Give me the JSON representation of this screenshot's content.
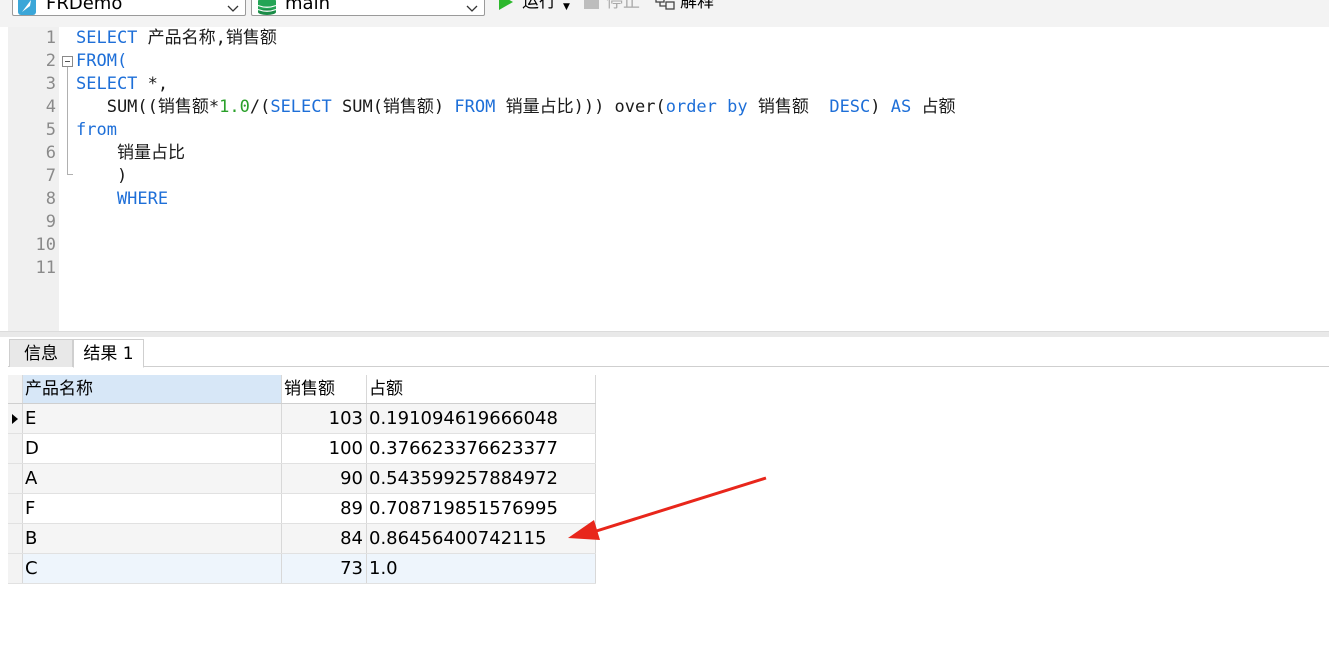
{
  "toolbar": {
    "connection": "FRDemo",
    "database": "main",
    "run_label": "运行",
    "stop_label": "停止",
    "explain_label": "解释",
    "icons": {
      "connection": "sqlite-feather-icon",
      "database": "database-icon",
      "run": "play-icon",
      "stop": "stop-icon",
      "explain": "explain-icon"
    }
  },
  "editor": {
    "line_numbers": [
      "1",
      "2",
      "3",
      "4",
      "5",
      "6",
      "7",
      "8",
      "9",
      "10",
      "11"
    ],
    "lines": [
      [
        {
          "t": "SELECT",
          "c": "kw"
        },
        {
          "t": " 产品名称,销售额",
          "c": ""
        }
      ],
      [
        {
          "t": "FROM(",
          "c": "kw"
        }
      ],
      [
        {
          "t": "SELECT",
          "c": "kw"
        },
        {
          "t": " *,",
          "c": ""
        }
      ],
      [
        {
          "t": "   SUM((销售额*",
          "c": ""
        },
        {
          "t": "1.0",
          "c": "num"
        },
        {
          "t": "/(",
          "c": ""
        },
        {
          "t": "SELECT",
          "c": "kw"
        },
        {
          "t": " SUM(销售额) ",
          "c": ""
        },
        {
          "t": "FROM",
          "c": "kw"
        },
        {
          "t": " 销量占比))) over(",
          "c": ""
        },
        {
          "t": "order by",
          "c": "kw"
        },
        {
          "t": " 销售额  ",
          "c": ""
        },
        {
          "t": "DESC",
          "c": "kw"
        },
        {
          "t": ") ",
          "c": ""
        },
        {
          "t": "AS",
          "c": "kw"
        },
        {
          "t": " 占额",
          "c": ""
        }
      ],
      [
        {
          "t": "from",
          "c": "kw"
        }
      ],
      [
        {
          "t": "    销量占比",
          "c": ""
        }
      ],
      [
        {
          "t": "    )",
          "c": ""
        }
      ],
      [
        {
          "t": "    WHERE",
          "c": "kw"
        }
      ],
      [],
      [],
      []
    ]
  },
  "result_tabs": [
    {
      "label": "信息",
      "active": false
    },
    {
      "label": "结果 1",
      "active": true
    }
  ],
  "grid": {
    "columns": [
      "产品名称",
      "销售额",
      "占额"
    ],
    "rows": [
      [
        "E",
        "103",
        "0.191094619666048"
      ],
      [
        "D",
        "100",
        "0.376623376623377"
      ],
      [
        "A",
        "90",
        "0.543599257884972"
      ],
      [
        "F",
        "89",
        "0.708719851576995"
      ],
      [
        "B",
        "84",
        "0.86456400742115"
      ],
      [
        "C",
        "73",
        "1.0"
      ]
    ],
    "current_row_marker_row": 0
  },
  "colors": {
    "keyword": "#1e6fd8",
    "number": "#2aa02a",
    "annotation_arrow": "#e8261b",
    "header_highlight": "#d7e7f7"
  }
}
